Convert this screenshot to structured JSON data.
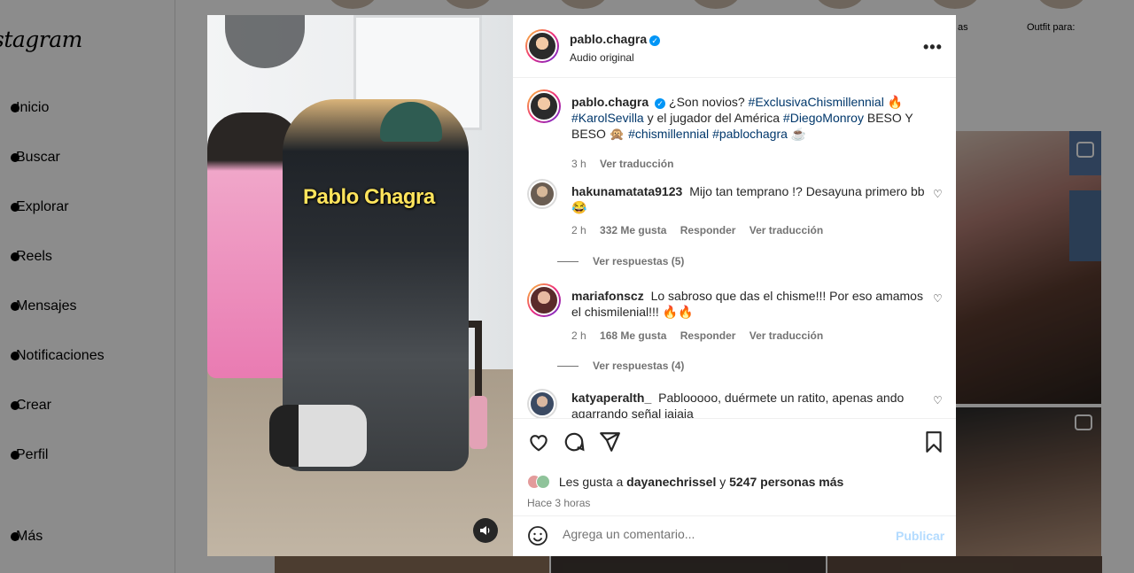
{
  "sidebar": {
    "logo": "stagram",
    "items": [
      {
        "label": "Inicio"
      },
      {
        "label": "Buscar"
      },
      {
        "label": "Explorar"
      },
      {
        "label": "Reels"
      },
      {
        "label": "Mensajes"
      },
      {
        "label": "Notificaciones"
      },
      {
        "label": "Crear"
      },
      {
        "label": "Perfil"
      }
    ],
    "more_label": "Más"
  },
  "stories": {
    "label_right": "Outfit para:",
    "label_mid": "as"
  },
  "post": {
    "media_caption_overlay": "Pablo Chagra",
    "author": {
      "username": "pablo.chagra",
      "verified": true,
      "audio": "Audio original"
    },
    "caption": {
      "username": "pablo.chagra",
      "text_1": "¿Son novios?",
      "tag_1": "#ExclusivaChismillennial",
      "emoji_1": "🔥",
      "tag_2": "#KarolSevilla",
      "text_2": "y el jugador del América",
      "tag_3": "#DiegoMonroy",
      "text_3": "BESO Y BESO",
      "emoji_2": "🙊",
      "tag_4": "#chismillennial",
      "tag_5": "#pablochagra",
      "emoji_3": "☕",
      "time": "3 h",
      "translate": "Ver traducción"
    },
    "comments": [
      {
        "username": "hakunamatata9123",
        "text": "Mijo tan temprano !? Desayuna primero bb 😂",
        "time": "2 h",
        "likes": "332 Me gusta",
        "reply": "Responder",
        "translate": "Ver traducción",
        "view_replies": "Ver respuestas (5)"
      },
      {
        "username": "mariafonscz",
        "text": "Lo sabroso que das el chisme!!! Por eso amamos el chismilenial!!! 🔥🔥",
        "time": "2 h",
        "likes": "168 Me gusta",
        "reply": "Responder",
        "translate": "Ver traducción",
        "view_replies": "Ver respuestas (4)"
      },
      {
        "username": "katyaperalth_",
        "text": "Pablooooo, duérmete un ratito, apenas ando agarrando señal jajaja"
      }
    ],
    "likes": {
      "prefix": "Les gusta a",
      "user": "dayanechrissel",
      "connector": "y",
      "others": "5247 personas más"
    },
    "posted_ago": "Hace 3 horas",
    "comment_box": {
      "placeholder": "Agrega un comentario...",
      "publish": "Publicar"
    }
  },
  "colors": {
    "accent": "#0095f6",
    "hashtag": "#00376b",
    "overlay_text": "#ffe45c"
  }
}
